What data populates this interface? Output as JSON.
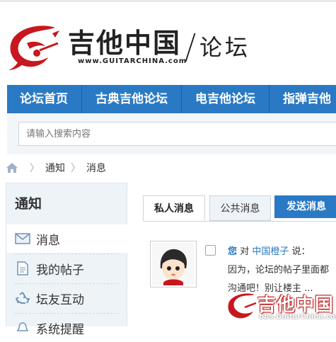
{
  "site": {
    "logo_text": "吉他中国",
    "logo_url": "www.GUITARCHINA.com",
    "section_text": "论坛"
  },
  "nav": {
    "items": [
      {
        "label": "论坛首页"
      },
      {
        "label": "古典吉他论坛"
      },
      {
        "label": "电吉他论坛"
      },
      {
        "label": "指弹吉他"
      }
    ]
  },
  "search": {
    "placeholder": "请输入搜索内容"
  },
  "breadcrumb": {
    "items": [
      "通知",
      "消息"
    ]
  },
  "sidebar": {
    "title": "通知",
    "items": [
      {
        "label": "消息",
        "icon": "envelope-icon",
        "active": true
      },
      {
        "label": "我的帖子",
        "icon": "document-icon"
      },
      {
        "label": "坛友互动",
        "icon": "recycle-icon"
      },
      {
        "label": "系统提醒",
        "icon": "bell-icon"
      }
    ]
  },
  "tabs": {
    "private_label": "私人消息",
    "public_label": "公共消息"
  },
  "send_label": "发送消息",
  "message": {
    "you": "您",
    "verb": "对",
    "user": "中国橙子",
    "said": "说：",
    "line2": "因为，论坛的帖子里面都",
    "line3": "沟通吧！别让楼主 ..."
  },
  "watermark": {
    "text": "吉他中国",
    "url": "bbs.GuitarChina.com"
  },
  "colors": {
    "nav_blue": "#2a79c4",
    "link_blue": "#2a79c4",
    "logo_red": "#c8171e"
  }
}
